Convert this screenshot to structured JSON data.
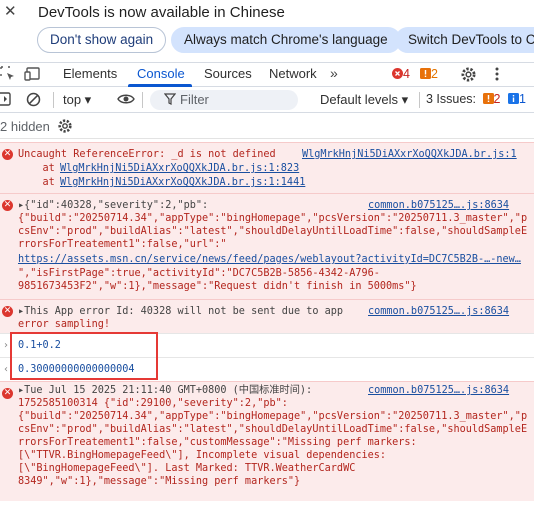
{
  "infobar": {
    "close_glyph": "✕",
    "message": "DevTools is now available in Chinese",
    "buttons": [
      "Don't show again",
      "Always match Chrome's language",
      "Switch DevTools to Ch"
    ]
  },
  "tabs": {
    "items": [
      "Elements",
      "Console",
      "Sources",
      "Network"
    ],
    "active": "Console",
    "more_glyph": "»",
    "error_count": "4",
    "warning_count": "2"
  },
  "toolbar": {
    "context": "top ▾",
    "filter_placeholder": "Filter",
    "levels": "Default levels ▾",
    "issues_label": "3 Issues:",
    "issues_errors": "2",
    "issues_info": "1"
  },
  "hidden": {
    "text": "2 hidden"
  },
  "messages": [
    {
      "lines": [
        "Uncaught ReferenceError: _d is not defined",
        "    at ",
        "    at "
      ],
      "links": [
        "WlgMrkHnjNi5DiAXxrXoQQXkJDA.br.js:1",
        "WlgMrkHnjNi5DiAXxrXoQQXkJDA.br.js:1:823",
        "WlgMrkHnjNi5DiAXxrXoQQXkJDA.br.js:1:1441"
      ]
    },
    {
      "source": "common.b075125….js:8634",
      "lines": [
        "▸{\"id\":40328,\"severity\":2,\"pb\":",
        "{\"build\":\"20250714.34\",\"appType\":\"bingHomepage\",\"pcsVersion\":\"20250711.3_master\",\"p",
        "csEnv\":\"prod\",\"buildAlias\":\"latest\",\"shouldDelayUntilLoadTime\":false,\"shouldSampleE",
        "rrorsForTreatement1\":false,\"url\":\"",
        "https://assets.msn.cn/service/news/feed/pages/weblayout?activityId=DC7C5B2B-…-new…",
        "\",\"isFirstPage\":true,\"activityId\":\"DC7C5B2B-5856-4342-A796-",
        "9851673453F2\",\"w\":1},\"message\":\"Request didn't finish in 5000ms\"}"
      ]
    },
    {
      "source": "common.b075125….js:8634",
      "lines": [
        "▸This App error Id: 40328 will not be sent due to app",
        "error sampling!"
      ]
    },
    {
      "source": "common.b075125….js:8634",
      "lines": [
        "▸Tue Jul 15 2025 21:11:40 GMT+0800 (中国标准时间):",
        "1752585100314 {\"id\":29100,\"severity\":2,\"pb\":",
        "{\"build\":\"20250714.34\",\"appType\":\"bingHomepage\",\"pcsVersion\":\"20250711.3_master\",\"p",
        "csEnv\":\"prod\",\"buildAlias\":\"latest\",\"shouldDelayUntilLoadTime\":false,\"shouldSampleE",
        "rrorsForTreatement1\":false,\"customMessage\":\"Missing perf markers:",
        "[\\\"TTVR.BingHomepageFeed\\\"], Incomplete visual dependencies:",
        "[\\\"BingHomepageFeed\\\"]. Last Marked: TTVR.WeatherCardWC",
        "8349\",\"w\":1},\"message\":\"Missing perf markers\"}"
      ]
    }
  ],
  "eval": {
    "input": "0.1+0.2",
    "output": "0.30000000000000004"
  }
}
